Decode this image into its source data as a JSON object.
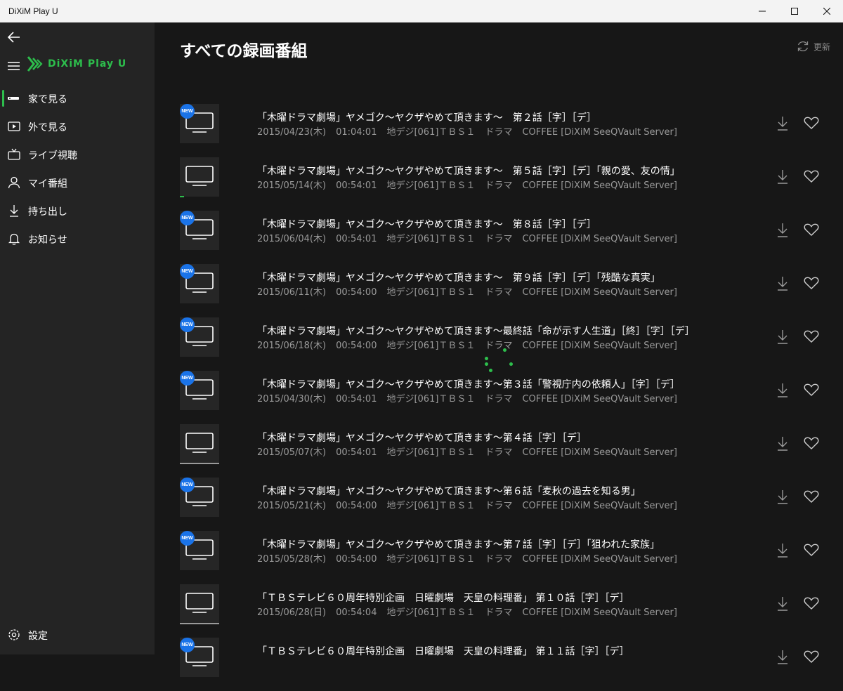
{
  "window": {
    "title": "DiXiM Play U"
  },
  "logo_text": "DiXiM Play U",
  "nav": [
    {
      "label": "家で見る",
      "icon": "home-tv-icon",
      "active": true
    },
    {
      "label": "外で見る",
      "icon": "play-box-icon"
    },
    {
      "label": "ライブ視聴",
      "icon": "live-tv-icon"
    },
    {
      "label": "マイ番組",
      "icon": "person-icon"
    },
    {
      "label": "持ち出し",
      "icon": "download-icon"
    },
    {
      "label": "お知らせ",
      "icon": "bell-icon"
    }
  ],
  "settings_label": "設定",
  "page_title": "すべての録画番組",
  "refresh_label": "更新",
  "badge_label": "NEW",
  "accent_color": "#2dbe4c",
  "badge_color": "#1a73e8",
  "recordings": [
    {
      "title": "「木曜ドラマ劇場」ヤメゴク〜ヤクザやめて頂きます〜　第２話［字］［デ］",
      "date": "2015/04/23(木)",
      "duration": "01:04:01",
      "channel": "地デジ[061]ＴＢＳ１",
      "genre": "ドラマ",
      "server": "COFFEE [DiXiM SeeQVault Server]",
      "is_new": true,
      "watched": 0
    },
    {
      "title": "「木曜ドラマ劇場」ヤメゴク〜ヤクザやめて頂きます〜　第５話［字］［デ］「親の愛、友の情」",
      "date": "2015/05/14(木)",
      "duration": "00:54:01",
      "channel": "地デジ[061]ＴＢＳ１",
      "genre": "ドラマ",
      "server": "COFFEE [DiXiM SeeQVault Server]",
      "is_new": false,
      "watched": 0.1
    },
    {
      "title": "「木曜ドラマ劇場」ヤメゴク〜ヤクザやめて頂きます〜　第８話［字］［デ］",
      "date": "2015/06/04(木)",
      "duration": "00:54:01",
      "channel": "地デジ[061]ＴＢＳ１",
      "genre": "ドラマ",
      "server": "COFFEE [DiXiM SeeQVault Server]",
      "is_new": true,
      "watched": 0
    },
    {
      "title": "「木曜ドラマ劇場」ヤメゴク〜ヤクザやめて頂きます〜　第９話［字］［デ］「残酷な真実」",
      "date": "2015/06/11(木)",
      "duration": "00:54:00",
      "channel": "地デジ[061]ＴＢＳ１",
      "genre": "ドラマ",
      "server": "COFFEE [DiXiM SeeQVault Server]",
      "is_new": true,
      "watched": 0
    },
    {
      "title": "「木曜ドラマ劇場」ヤメゴク〜ヤクザやめて頂きます〜最終話「命が示す人生道」［終］［字］［デ］",
      "date": "2015/06/18(木)",
      "duration": "00:54:00",
      "channel": "地デジ[061]ＴＢＳ１",
      "genre": "ドラマ",
      "server": "COFFEE [DiXiM SeeQVault Server]",
      "is_new": true,
      "watched": 0
    },
    {
      "title": "「木曜ドラマ劇場」ヤメゴク〜ヤクザやめて頂きます〜第３話「警視庁内の依頼人」［字］［デ］",
      "date": "2015/04/30(木)",
      "duration": "00:54:01",
      "channel": "地デジ[061]ＴＢＳ１",
      "genre": "ドラマ",
      "server": "COFFEE [DiXiM SeeQVault Server]",
      "is_new": true,
      "watched": 0
    },
    {
      "title": "「木曜ドラマ劇場」ヤメゴク〜ヤクザやめて頂きます〜第４話［字］［デ］",
      "date": "2015/05/07(木)",
      "duration": "00:54:01",
      "channel": "地デジ[061]ＴＢＳ１",
      "genre": "ドラマ",
      "server": "COFFEE [DiXiM SeeQVault Server]",
      "is_new": false,
      "watched": 1
    },
    {
      "title": "「木曜ドラマ劇場」ヤメゴク〜ヤクザやめて頂きます〜第６話「麦秋の過去を知る男」",
      "date": "2015/05/21(木)",
      "duration": "00:54:00",
      "channel": "地デジ[061]ＴＢＳ１",
      "genre": "ドラマ",
      "server": "COFFEE [DiXiM SeeQVault Server]",
      "is_new": true,
      "watched": 0
    },
    {
      "title": "「木曜ドラマ劇場」ヤメゴク〜ヤクザやめて頂きます〜第７話［字］［デ］「狙われた家族」",
      "date": "2015/05/28(木)",
      "duration": "00:54:00",
      "channel": "地デジ[061]ＴＢＳ１",
      "genre": "ドラマ",
      "server": "COFFEE [DiXiM SeeQVault Server]",
      "is_new": true,
      "watched": 0
    },
    {
      "title": "「ＴＢＳテレビ６０周年特別企画　日曜劇場　天皇の料理番」 第１０話［字］［デ］",
      "date": "2015/06/28(日)",
      "duration": "00:54:04",
      "channel": "地デジ[061]ＴＢＳ１",
      "genre": "ドラマ",
      "server": "COFFEE [DiXiM SeeQVault Server]",
      "is_new": false,
      "watched": 1
    },
    {
      "title": "「ＴＢＳテレビ６０周年特別企画　日曜劇場　天皇の料理番」 第１１話［字］［デ］",
      "date": "",
      "duration": "",
      "channel": "",
      "genre": "",
      "server": "",
      "is_new": true,
      "watched": 0
    }
  ]
}
